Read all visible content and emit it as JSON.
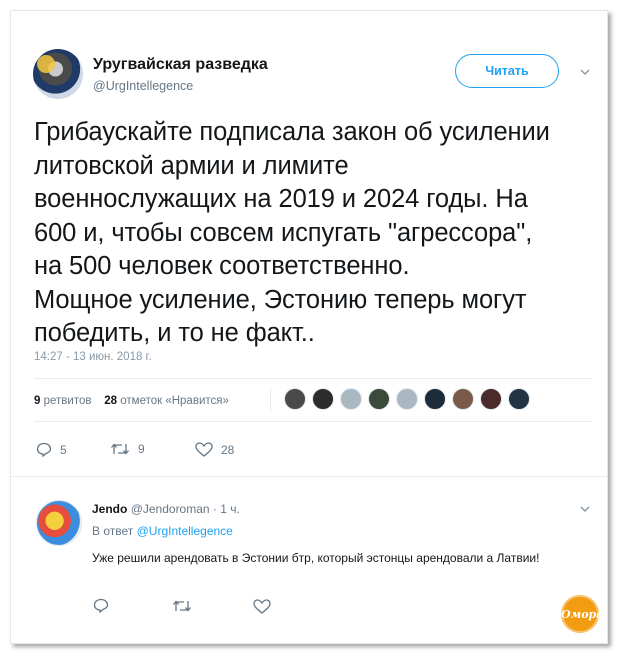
{
  "tweet": {
    "display_name": "Уругвайская разведка",
    "handle": "@UrgIntellegence",
    "follow_label": "Читать",
    "text_lines": [
      "Грибаускайте подписала закон об усилении",
      "литовской армии и лимите",
      "военнослужащих на 2019 и 2024 годы. На",
      "600 и, чтобы совсем испугать \"агрессора\",",
      "на 500 человек соответственно.",
      "Мощное усиление, Эстонию теперь могут",
      "победить, и то не факт.."
    ],
    "timestamp": "14:27 - 13 июн. 2018 г.",
    "stats": {
      "retweets_count": "9",
      "retweets_label": "ретвитов",
      "likes_count": "28",
      "likes_label": "отметок «Нравится»"
    },
    "actions": {
      "replies": "5",
      "retweets": "9",
      "likes": "28"
    }
  },
  "reply": {
    "name": "Jendo",
    "handle_time": "@Jendoroman · 1 ч.",
    "reply_prefix": "В ответ",
    "reply_to": "@UrgIntellegence",
    "text": "Уже решили арендовать в Эстонии бтр, который эстонцы арендовали а Латвии!"
  },
  "watermark": "Юмора",
  "colors": {
    "accent": "#1da1f2",
    "muted": "#657786",
    "text": "#14171a"
  }
}
